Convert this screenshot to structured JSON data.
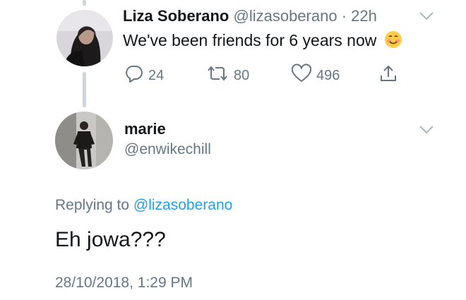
{
  "original_tweet": {
    "display_name": "Liza Soberano",
    "handle": "@lizasoberano",
    "separator": "·",
    "time": "22h",
    "text": "We've been friends for 6 years now",
    "emoji": "smiling-face-icon",
    "replies": "24",
    "retweets": "80",
    "likes": "496"
  },
  "reply": {
    "display_name": "marie",
    "handle": "@enwikechill",
    "replying_prefix": "Replying to",
    "replying_to": "@lizasoberano",
    "text": "Eh jowa???",
    "timestamp": "28/10/2018, 1:29 PM"
  },
  "colors": {
    "text": "#14171a",
    "muted": "#657786",
    "link": "#1da1f2",
    "thread_line": "#ccd6dd"
  }
}
